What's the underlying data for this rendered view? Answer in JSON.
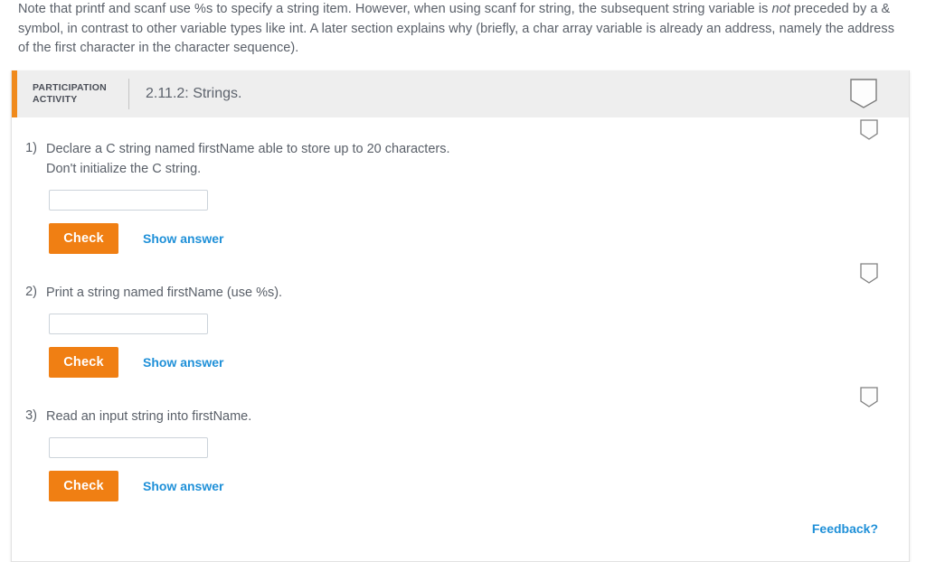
{
  "intro": {
    "part1": "Note that printf and scanf use %s to specify a string item. However, when using scanf for string, the subsequent string variable is ",
    "emphasis": "not",
    "part2": " preceded by a & symbol, in contrast to other variable types like int. A later section explains why (briefly, a char array variable is already an address, namely the address of the first character in the character sequence)."
  },
  "activity": {
    "label": "PARTICIPATION ACTIVITY",
    "label_line1": "PARTICIPATION",
    "label_line2": "ACTIVITY",
    "title": "2.11.2: Strings.",
    "bookmark_icon": "bookmark-icon"
  },
  "questions": [
    {
      "number": "1)",
      "text": "Declare a C string named firstName able to store up to 20 characters.\nDon't initialize the C string.",
      "input_value": "",
      "input_placeholder": "",
      "check_label": "Check",
      "show_answer_label": "Show answer",
      "bookmark_icon": "bookmark-icon"
    },
    {
      "number": "2)",
      "text": "Print a string named firstName (use %s).",
      "input_value": "",
      "input_placeholder": "",
      "check_label": "Check",
      "show_answer_label": "Show answer",
      "bookmark_icon": "bookmark-icon"
    },
    {
      "number": "3)",
      "text": "Read an input string into firstName.",
      "input_value": "",
      "input_placeholder": "",
      "check_label": "Check",
      "show_answer_label": "Show answer",
      "bookmark_icon": "bookmark-icon"
    }
  ],
  "footer": {
    "feedback_label": "Feedback?"
  },
  "colors": {
    "accent_orange": "#f08a1c",
    "button_orange": "#f07f13",
    "link_blue": "#1f90d8",
    "header_gray": "#eeeeee",
    "text_gray": "#5a6069"
  }
}
